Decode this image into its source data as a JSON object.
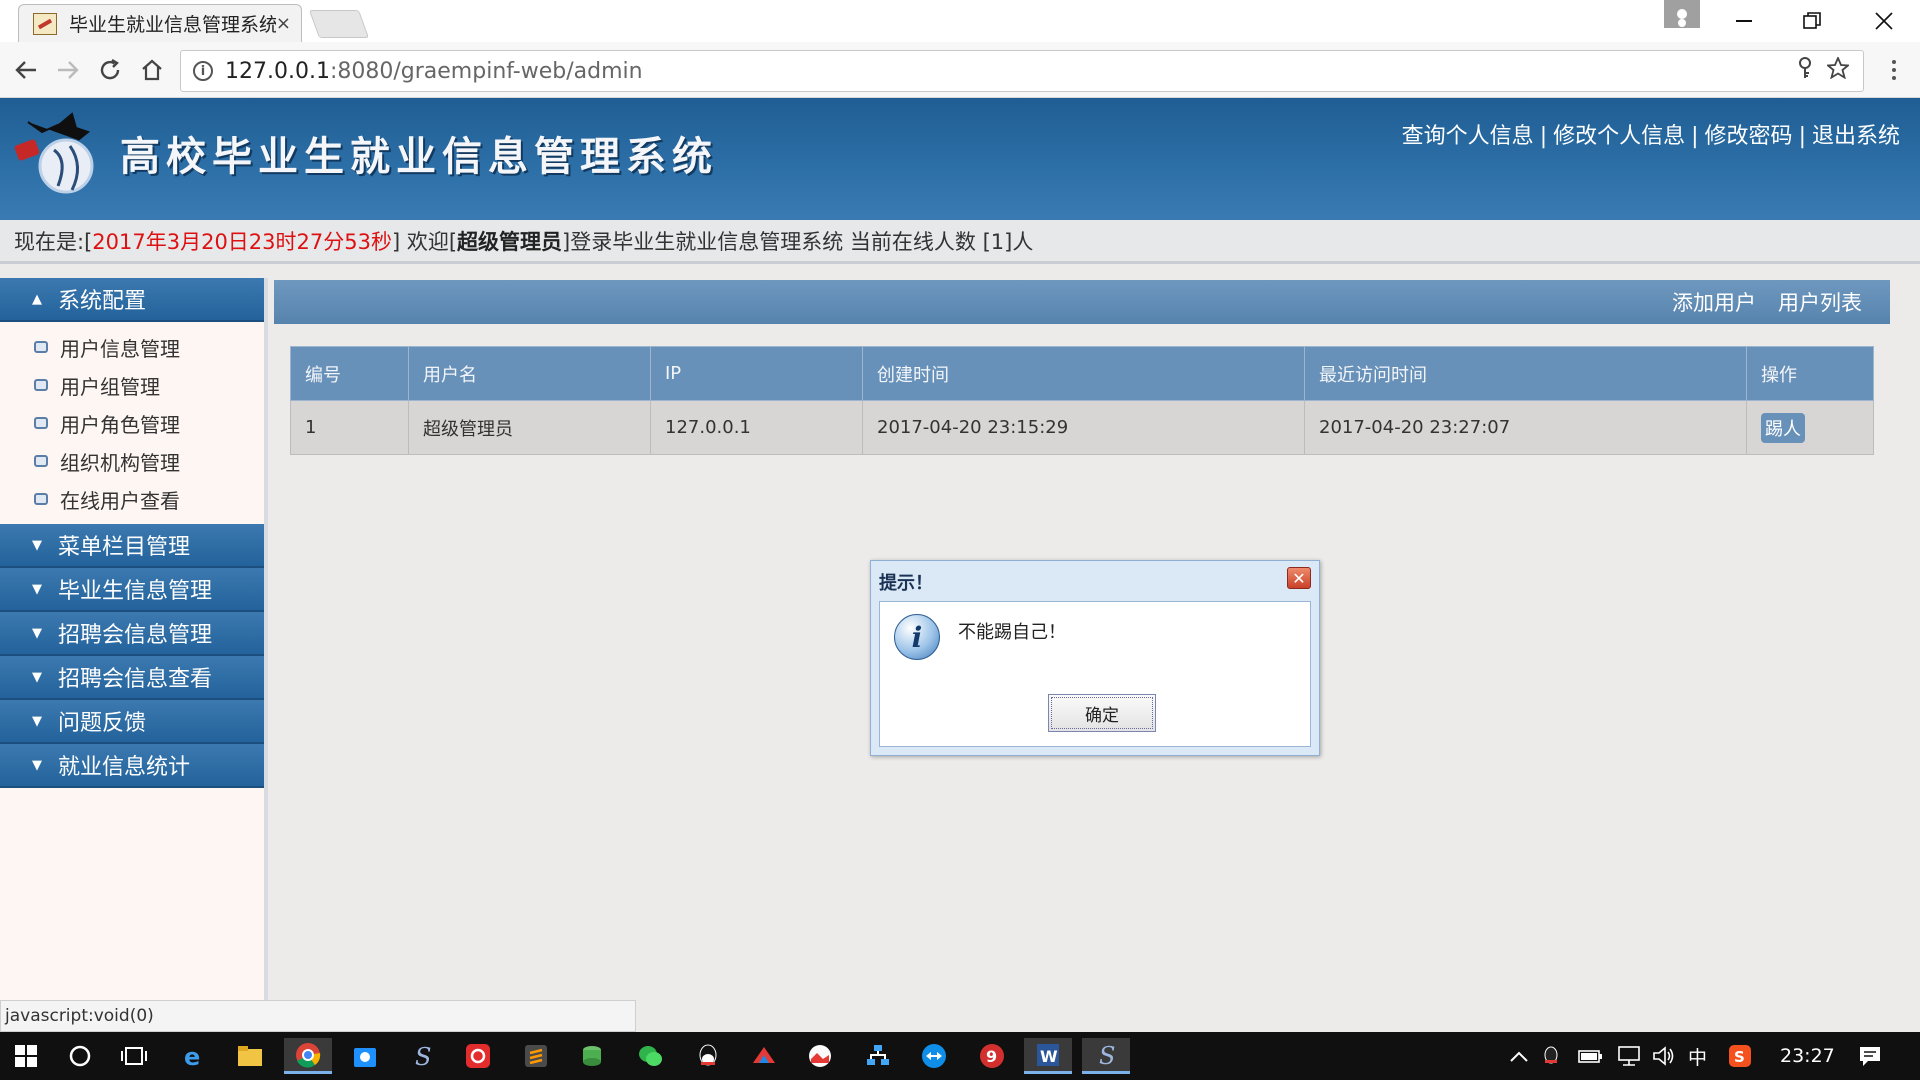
{
  "browser": {
    "tab_title": "毕业生就业信息管理系统",
    "tab_close": "×",
    "url_host": "127.0.0.1",
    "url_rest": ":8080/graempinf-web/admin",
    "status_url": "javascript:void(0)"
  },
  "header": {
    "site_title": "高校毕业生就业信息管理系统",
    "links": [
      "查询个人信息",
      "修改个人信息",
      "修改密码",
      "退出系统"
    ],
    "separator": "|"
  },
  "status": {
    "prefix": "现在是:[",
    "datetime": "2017年3月20日23时27分53秒",
    "welcome_open": "] 欢迎[",
    "role": "超级管理员",
    "suffix": "]登录毕业生就业信息管理系统 当前在线人数 [1]人"
  },
  "sidebar": {
    "open_section": {
      "label": "系统配置",
      "arrow": "▲"
    },
    "items": [
      "用户信息管理",
      "用户组管理",
      "用户角色管理",
      "组织机构管理",
      "在线用户查看"
    ],
    "sections": [
      {
        "label": "菜单栏目管理",
        "arrow": "▼"
      },
      {
        "label": "毕业生信息管理",
        "arrow": "▼"
      },
      {
        "label": "招聘会信息管理",
        "arrow": "▼"
      },
      {
        "label": "招聘会信息查看",
        "arrow": "▼"
      },
      {
        "label": "问题反馈",
        "arrow": "▼"
      },
      {
        "label": "就业信息统计",
        "arrow": "▼"
      }
    ]
  },
  "main": {
    "actions": [
      "添加用户",
      "用户列表"
    ],
    "table": {
      "columns": [
        "编号",
        "用户名",
        "IP",
        "创建时间",
        "最近访问时间",
        "操作"
      ],
      "rows": [
        {
          "id": "1",
          "username": "超级管理员",
          "ip": "127.0.0.1",
          "created": "2017-04-20 23:15:29",
          "last_visit": "2017-04-20 23:27:07",
          "action": "踢人"
        }
      ]
    }
  },
  "dialog": {
    "title": "提示！",
    "message": "不能踢自己！",
    "ok": "确定",
    "icon_glyph": "i"
  },
  "taskbar": {
    "ime": "中",
    "time": "23:27"
  },
  "colors": {
    "header_blue": "#2c6ea6",
    "table_header": "#6891b9",
    "highlight_red": "#dd1111"
  }
}
